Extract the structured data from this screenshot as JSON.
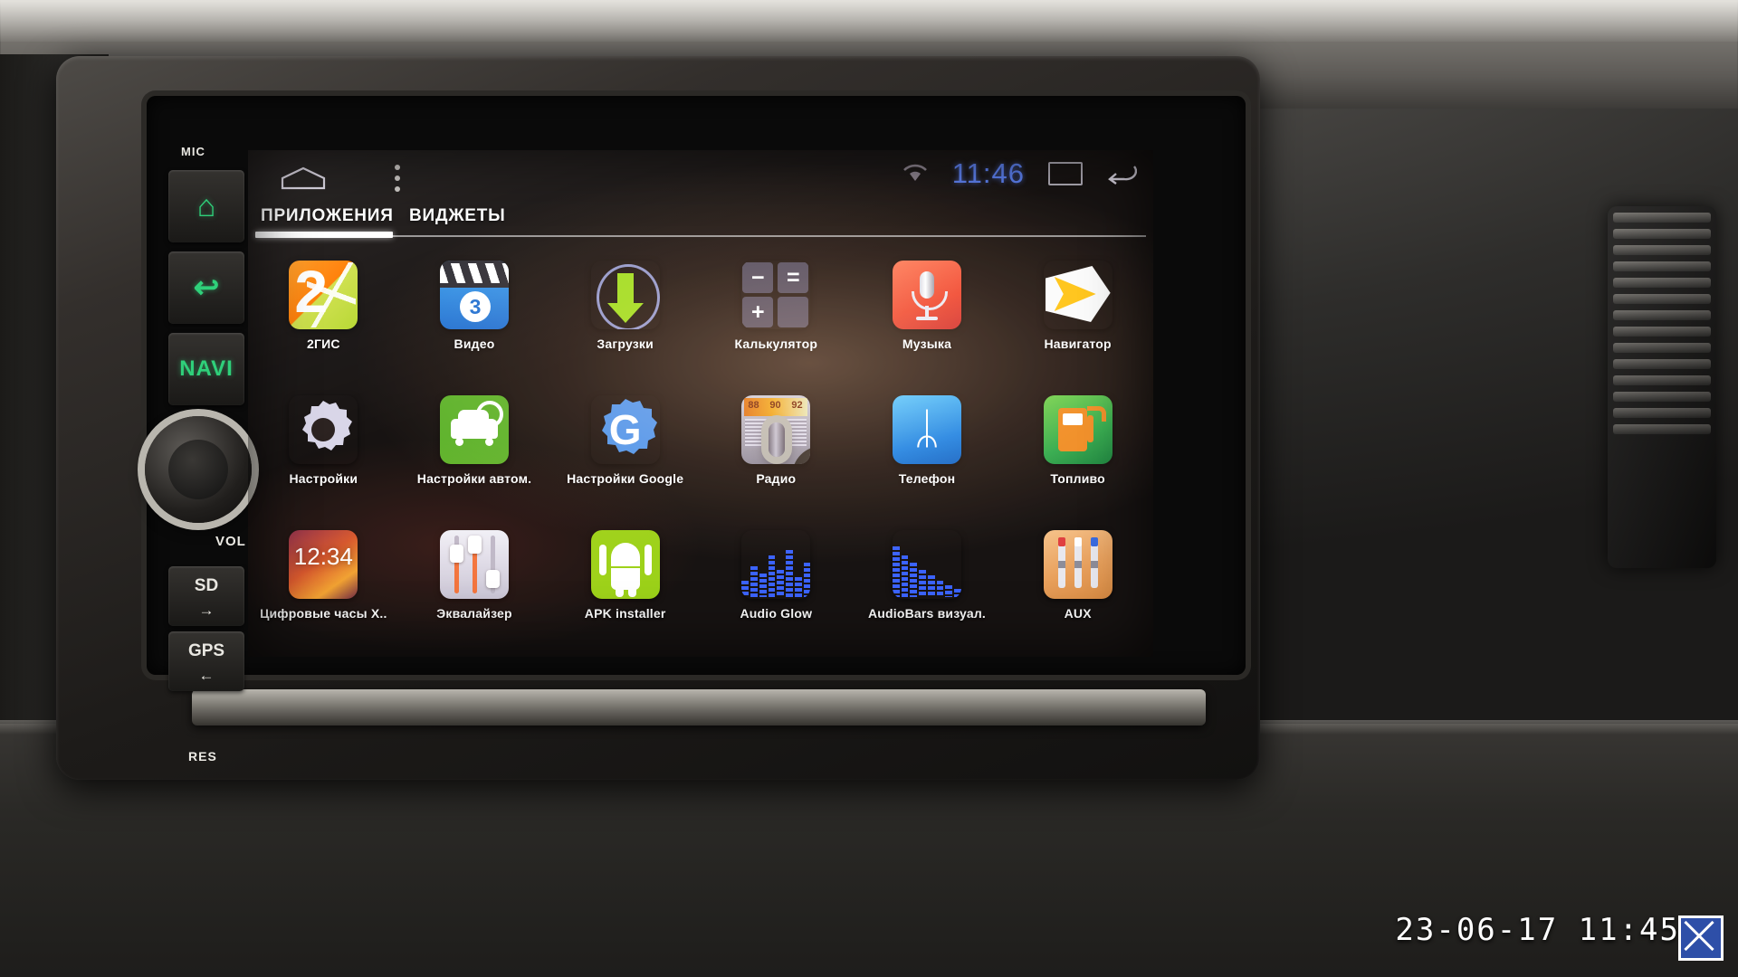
{
  "device": {
    "hardware_buttons": [
      {
        "name": "mic-label",
        "label": "MIC"
      },
      {
        "name": "home-button",
        "label": "⌂"
      },
      {
        "name": "back-button",
        "label": "↩"
      },
      {
        "name": "navi-button",
        "label": "NAVI"
      },
      {
        "name": "sd-button",
        "label": "SD",
        "sub": "→"
      },
      {
        "name": "gps-button",
        "label": "GPS",
        "sub": "←"
      }
    ],
    "vol_label": "VOL",
    "res_label": "RES"
  },
  "statusbar": {
    "home_icon": "home-icon",
    "menu_icon": "overflow-menu-icon",
    "wifi_icon": "wifi-icon",
    "time": "11:46",
    "recents_icon": "recents-icon",
    "back_icon": "back-icon",
    "time_color": "#5b7ff0"
  },
  "tabs": [
    {
      "label": "ПРИЛОЖЕНИЯ",
      "active": true
    },
    {
      "label": "ВИДЖЕТЫ",
      "active": false
    }
  ],
  "apps": [
    {
      "label": "2ГИС",
      "icon": "2gis-icon",
      "n": "2"
    },
    {
      "label": "Видео",
      "icon": "video-icon",
      "badge": "3"
    },
    {
      "label": "Загрузки",
      "icon": "downloads-icon"
    },
    {
      "label": "Калькулятор",
      "icon": "calculator-icon",
      "k1": "−",
      "k2": "=",
      "k3": "+",
      "k4": ""
    },
    {
      "label": "Музыка",
      "icon": "music-icon"
    },
    {
      "label": "Навигатор",
      "icon": "navigator-icon"
    },
    {
      "label": "Настройки",
      "icon": "settings-icon"
    },
    {
      "label": "Настройки автом.",
      "icon": "car-settings-icon"
    },
    {
      "label": "Настройки Google",
      "icon": "google-settings-icon",
      "g": "G"
    },
    {
      "label": "Радио",
      "icon": "radio-icon",
      "s1": "88",
      "s2": "90",
      "s3": "92"
    },
    {
      "label": "Телефон",
      "icon": "bluetooth-phone-icon",
      "glyph": "ᛦ"
    },
    {
      "label": "Топливо",
      "icon": "fuel-icon"
    },
    {
      "label": "Цифровые часы Х..",
      "icon": "digital-clock-icon",
      "time": "12:34"
    },
    {
      "label": "Эквалайзер",
      "icon": "equalizer-icon"
    },
    {
      "label": "APK installer",
      "icon": "apk-installer-icon"
    },
    {
      "label": "Audio Glow",
      "icon": "audio-glow-icon"
    },
    {
      "label": "AudioBars визуал.",
      "icon": "audiobars-icon"
    },
    {
      "label": "AUX",
      "icon": "aux-icon"
    }
  ],
  "camera": {
    "timestamp": "23-06-17  11:45"
  }
}
